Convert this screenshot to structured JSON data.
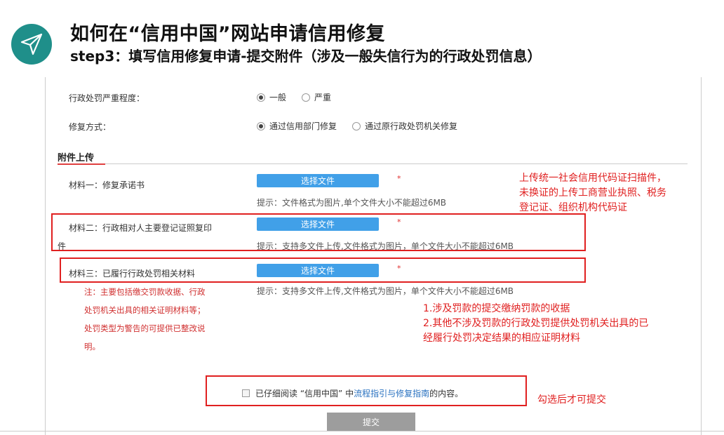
{
  "header": {
    "title": "如何在“信用中国”网站申请信用修复",
    "subtitle": "step3：填写信用修复申请-提交附件（涉及一般失信行为的行政处罚信息）"
  },
  "form": {
    "severity": {
      "label": "行政处罚严重程度：",
      "options": [
        "一般",
        "严重"
      ],
      "selected": "一般"
    },
    "method": {
      "label": "修复方式：",
      "options": [
        "通过信用部门修复",
        "通过原行政处罚机关修复"
      ],
      "selected": "通过信用部门修复"
    },
    "section_title": "附件上传",
    "materials": [
      {
        "label": "材料一：修复承诺书",
        "button": "选择文件",
        "required": "*",
        "hint": "提示：文件格式为图片,单个文件大小不能超过6MB"
      },
      {
        "label_line1": "材料二：行政相对人主要登记证照复印",
        "label_line2": "件",
        "button": "选择文件",
        "required": "*",
        "hint": "提示：支持多文件上传,文件格式为图片，单个文件大小不能超过6MB"
      },
      {
        "label": "材料三：已履行行政处罚相关材料",
        "button": "选择文件",
        "required": "*",
        "hint": "提示：支持多文件上传,文件格式为图片，单个文件大小不能超过6MB"
      }
    ],
    "note_lines": [
      "注：主要包括缴交罚款收据、行政",
      "处罚机关出具的相关证明材料等；",
      "处罚类型为警告的可提供已整改说",
      "明。"
    ],
    "agreement": {
      "prefix": "已仔细阅读 “信用中国” 中",
      "link": "流程指引与修复指南",
      "suffix": "的内容。"
    },
    "submit_label": "提交"
  },
  "annotations": {
    "license_lines": [
      "上传统一社会信用代码证扫描件，",
      "未换证的上传工商营业执照、税务",
      "登记证、组织机构代码证"
    ],
    "penalty_lines": [
      "1.涉及罚款的提交缴纳罚款的收据",
      "2.其他不涉及罚款的行政处罚提供处罚机关出具的已",
      "经履行处罚决定结果的相应证明材料"
    ],
    "checkbox_note": "勾选后才可提交"
  },
  "colors": {
    "accent": "#1f8f8a",
    "button": "#41a0e8",
    "highlight": "#e02020",
    "link": "#2a72c0",
    "submit": "#9d9d9d"
  }
}
